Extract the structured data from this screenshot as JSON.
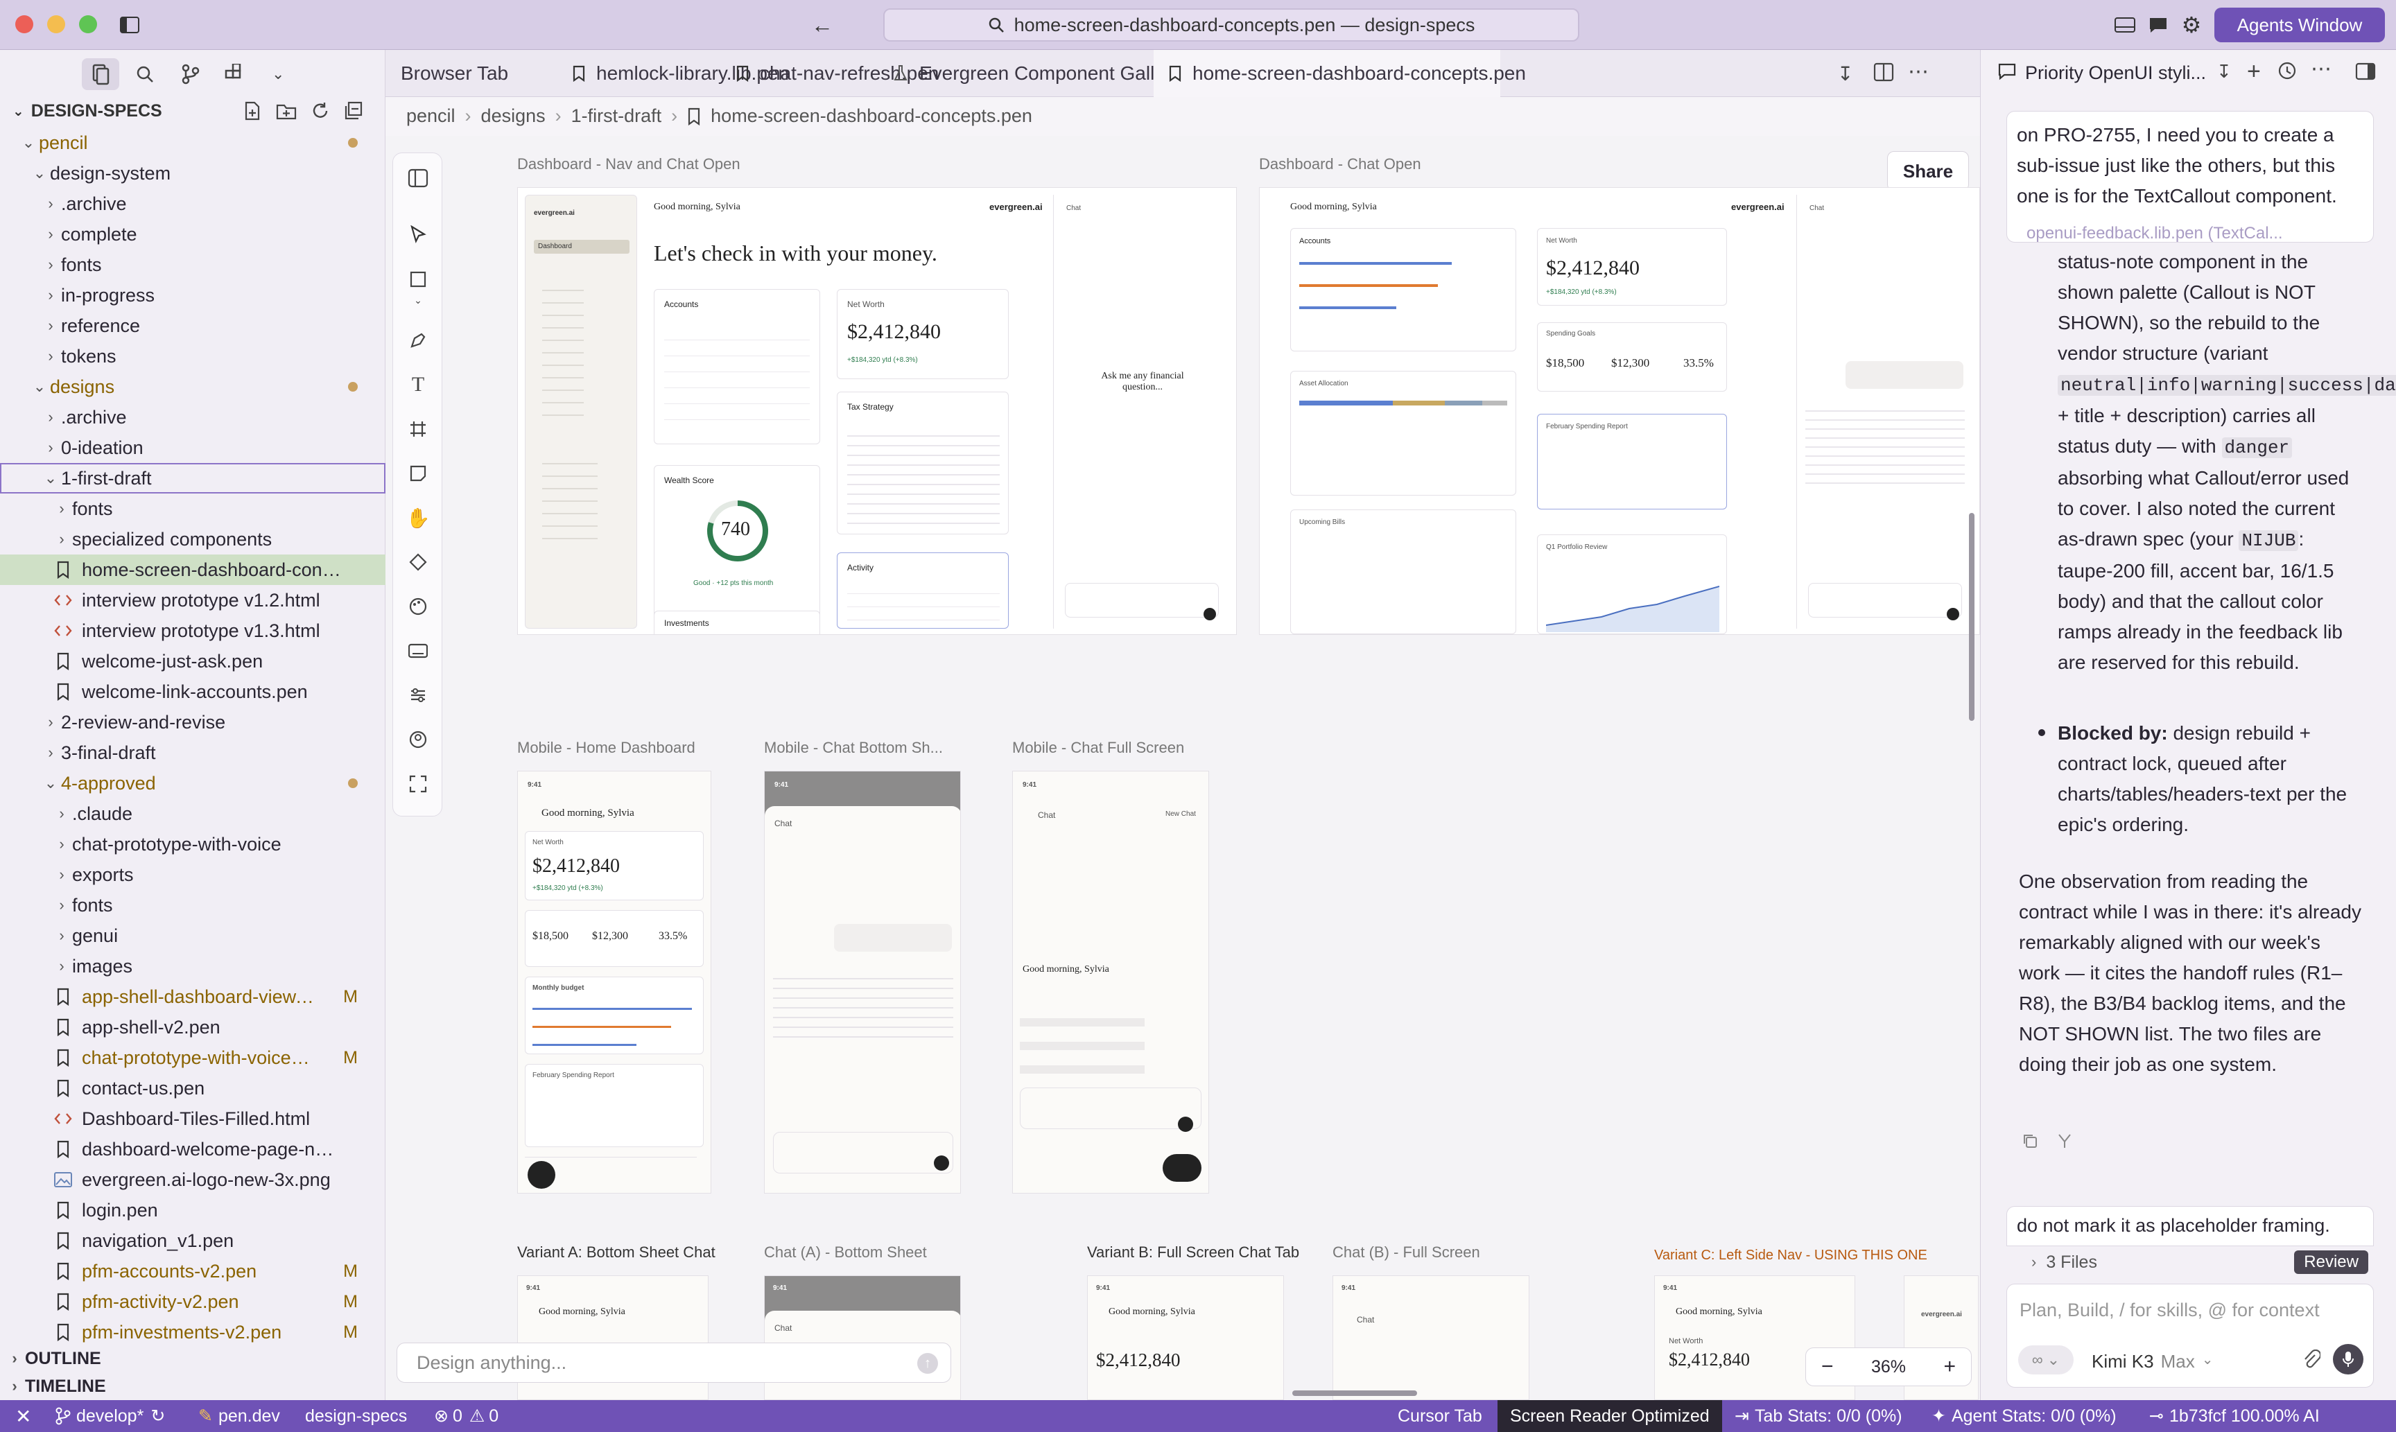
{
  "window": {
    "search_title": "home-screen-dashboard-concepts.pen — design-specs",
    "agents_button": "Agents Window"
  },
  "sidebar": {
    "root_label": "DESIGN-SPECS",
    "tree": [
      {
        "label": "pencil",
        "kind": "folder",
        "open": true,
        "indent": 1,
        "color": "#8a6300",
        "dot": true
      },
      {
        "label": "design-system",
        "kind": "folder",
        "open": true,
        "indent": 2
      },
      {
        "label": ".archive",
        "kind": "folder",
        "open": false,
        "indent": 3
      },
      {
        "label": "complete",
        "kind": "folder",
        "open": false,
        "indent": 3
      },
      {
        "label": "fonts",
        "kind": "folder",
        "open": false,
        "indent": 3
      },
      {
        "label": "in-progress",
        "kind": "folder",
        "open": false,
        "indent": 3
      },
      {
        "label": "reference",
        "kind": "folder",
        "open": false,
        "indent": 3
      },
      {
        "label": "tokens",
        "kind": "folder",
        "open": false,
        "indent": 3
      },
      {
        "label": "designs",
        "kind": "folder",
        "open": true,
        "indent": 2,
        "color": "#8a6300",
        "dot": true
      },
      {
        "label": ".archive",
        "kind": "folder",
        "open": false,
        "indent": 3
      },
      {
        "label": "0-ideation",
        "kind": "folder",
        "open": false,
        "indent": 3
      },
      {
        "label": "1-first-draft",
        "kind": "folder",
        "open": true,
        "indent": 3,
        "focused": true
      },
      {
        "label": "fonts",
        "kind": "folder",
        "open": false,
        "indent": 4
      },
      {
        "label": "specialized components",
        "kind": "folder",
        "open": false,
        "indent": 4
      },
      {
        "label": "home-screen-dashboard-concept...",
        "kind": "pen",
        "indent": 4,
        "selected": true
      },
      {
        "label": "interview prototype v1.2.html",
        "kind": "html",
        "indent": 4
      },
      {
        "label": "interview prototype v1.3.html",
        "kind": "html",
        "indent": 4
      },
      {
        "label": "welcome-just-ask.pen",
        "kind": "pen",
        "indent": 4
      },
      {
        "label": "welcome-link-accounts.pen",
        "kind": "pen",
        "indent": 4
      },
      {
        "label": "2-review-and-revise",
        "kind": "folder",
        "open": false,
        "indent": 3
      },
      {
        "label": "3-final-draft",
        "kind": "folder",
        "open": false,
        "indent": 3
      },
      {
        "label": "4-approved",
        "kind": "folder",
        "open": true,
        "indent": 3,
        "color": "#8a6300",
        "dot": true
      },
      {
        "label": ".claude",
        "kind": "folder",
        "open": false,
        "indent": 4
      },
      {
        "label": "chat-prototype-with-voice",
        "kind": "folder",
        "open": false,
        "indent": 4
      },
      {
        "label": "exports",
        "kind": "folder",
        "open": false,
        "indent": 4
      },
      {
        "label": "fonts",
        "kind": "folder",
        "open": false,
        "indent": 4
      },
      {
        "label": "genui",
        "kind": "folder",
        "open": false,
        "indent": 4
      },
      {
        "label": "images",
        "kind": "folder",
        "open": false,
        "indent": 4
      },
      {
        "label": "app-shell-dashboard-view.pen",
        "kind": "pen",
        "indent": 4,
        "color": "#8a6300",
        "badge": "M"
      },
      {
        "label": "app-shell-v2.pen",
        "kind": "pen",
        "indent": 4
      },
      {
        "label": "chat-prototype-with-voice.pen",
        "kind": "pen",
        "indent": 4,
        "color": "#8a6300",
        "badge": "M"
      },
      {
        "label": "contact-us.pen",
        "kind": "pen",
        "indent": 4
      },
      {
        "label": "Dashboard-Tiles-Filled.html",
        "kind": "html",
        "indent": 4
      },
      {
        "label": "dashboard-welcome-page-non-pl...",
        "kind": "pen",
        "indent": 4
      },
      {
        "label": "evergreen.ai-logo-new-3x.png",
        "kind": "img",
        "indent": 4
      },
      {
        "label": "login.pen",
        "kind": "pen",
        "indent": 4
      },
      {
        "label": "navigation_v1.pen",
        "kind": "pen",
        "indent": 4
      },
      {
        "label": "pfm-accounts-v2.pen",
        "kind": "pen",
        "indent": 4,
        "color": "#8a6300",
        "badge": "M"
      },
      {
        "label": "pfm-activity-v2.pen",
        "kind": "pen",
        "indent": 4,
        "color": "#8a6300",
        "badge": "M"
      },
      {
        "label": "pfm-investments-v2.pen",
        "kind": "pen",
        "indent": 4,
        "color": "#8a6300",
        "badge": "M"
      }
    ],
    "outline_label": "OUTLINE",
    "timeline_label": "TIMELINE"
  },
  "tabs": [
    {
      "label": "Browser Tab",
      "icon": "none"
    },
    {
      "label": "hemlock-library.lib.pen",
      "icon": "pen"
    },
    {
      "label": "chat-nav-refresh.pen",
      "icon": "pen"
    },
    {
      "label": "Evergreen Component Gallery",
      "icon": "flask"
    },
    {
      "label": "home-screen-dashboard-concepts.pen",
      "icon": "pen",
      "active": true
    }
  ],
  "breadcrumb": [
    "pencil",
    "designs",
    "1-first-draft",
    "home-screen-dashboard-concepts.pen"
  ],
  "canvas": {
    "share": "Share",
    "frames": {
      "nav_chat_open": "Dashboard - Nav and Chat Open",
      "chat_open": "Dashboard - Chat Open",
      "mobile_home": "Mobile - Home Dashboard",
      "mobile_bottom": "Mobile - Chat Bottom Sh...",
      "mobile_full": "Mobile - Chat Full Screen",
      "variant_a": "Variant A: Bottom Sheet Chat",
      "chat_a": "Chat (A) - Bottom Sheet",
      "variant_b": "Variant B: Full Screen Chat Tab",
      "chat_b": "Chat (B) - Full Screen",
      "variant_c": "Variant C: Left Side Nav - USING THIS ONE"
    },
    "mock": {
      "greeting": "Good morning, Sylvia",
      "brand": "evergreen.ai",
      "headline": "Let's check in with your money.",
      "net_worth_label": "Net Worth",
      "net_worth": "$2,412,840",
      "net_worth_delta": "+$184,320 ytd (+8.3%)",
      "accounts": "Accounts",
      "tax_strategy": "Tax Strategy",
      "wealth_score": "Wealth Score",
      "wealth_value": "740",
      "wealth_note": "Good · +12 pts this month",
      "investments": "Investments",
      "activity": "Activity",
      "chat": "Chat",
      "ask_prompt": "Ask me any financial question...",
      "income": "$18,500",
      "spending": "$12,300",
      "savings_rate": "33.5%",
      "spending_goals": "Spending Goals",
      "feb_report": "February Spending Report",
      "asset_allocation": "Asset Allocation",
      "upcoming_bills": "Upcoming Bills",
      "q1_review": "Q1 Portfolio Review",
      "monthly_budget": "Monthly budget",
      "time": "9:41",
      "new_chat": "New Chat",
      "dashboard": "Dashboard"
    },
    "chat_placeholder": "Design anything...",
    "zoom": "36%"
  },
  "right_panel": {
    "title": "Priority OpenUI styli...",
    "user_message": "on PRO-2755, I need you to create a sub-issue just like the others, but this one is for the TextCallout component.",
    "attachment": "openui-feedback.lib.pen (TextCal...",
    "p1_a": "status-note component in the shown palette (Callout is NOT SHOWN), so the rebuild to the vendor structure (variant",
    "p1_code1": "neutral|info|warning|success|danger",
    "p1_b": "+ title + description) carries all status duty — with",
    "p1_code2": "danger",
    "p1_c": "absorbing what Callout/error used to cover. I also noted the current as-drawn spec (your",
    "p1_code3": "NIJUB",
    "p1_d": ": taupe-200 fill, accent bar, 16/1.5 body) and that the callout color ramps already in the feedback lib are reserved for this rebuild.",
    "bullet_bold": "Blocked by:",
    "bullet_text": "design rebuild + contract lock, queued after charts/tables/headers-text per the epic's ordering.",
    "p2": "One observation from reading the contract while I was in there: it's already remarkably aligned with our week's work — it cites the handoff rules (R1–R8), the B3/B4 backlog items, and the NOT SHOWN list. The two files are doing their job as one system.",
    "pending": "do not mark it as placeholder framing.",
    "files": "3 Files",
    "review": "Review",
    "input_placeholder": "Plan, Build, / for skills, @ for context",
    "model": "Kimi K3",
    "mode": "Max"
  },
  "status": {
    "branch": "develop*",
    "site": "pen.dev",
    "repo": "design-specs",
    "problems": "0",
    "warnings": "0",
    "cursor_tab": "Cursor Tab",
    "screen_reader": "Screen Reader Optimized",
    "tab_stats": "Tab Stats: 0/0 (0%)",
    "agent_stats": "Agent Stats: 0/0 (0%)",
    "commit": "1b73fcf 100.00% AI"
  },
  "colors": {
    "accent": "#6f52b6",
    "modified": "#8a6300",
    "green": "#2f7d4f"
  }
}
